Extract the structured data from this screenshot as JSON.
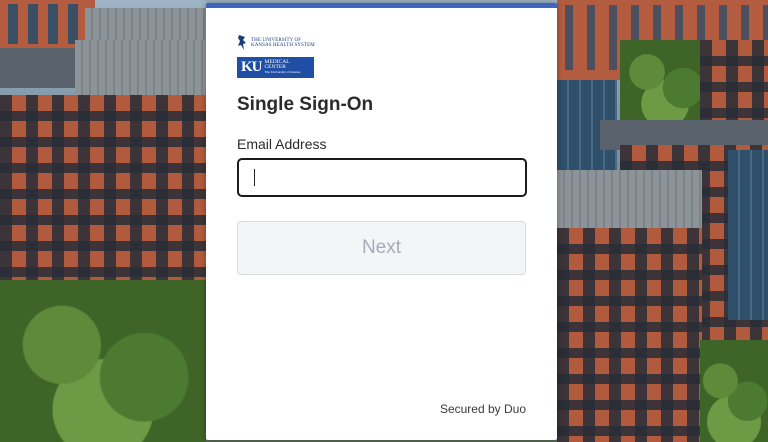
{
  "logo": {
    "institution_line1": "THE UNIVERSITY OF",
    "institution_line2": "KANSAS HEALTH SYSTEM",
    "ku_letters": "KU",
    "med_line1": "MEDICAL",
    "med_line2": "CENTER",
    "sub_line": "The University of Kansas",
    "brand_color": "#1f4fa5"
  },
  "form": {
    "title": "Single Sign-On",
    "email_label": "Email Address",
    "email_value": "",
    "next_label": "Next"
  },
  "footer": {
    "secured_text": "Secured by Duo"
  },
  "colors": {
    "accent_bar": "#3f65c0",
    "button_disabled_bg": "#f4f5f7",
    "button_disabled_text": "#a5acb7"
  }
}
